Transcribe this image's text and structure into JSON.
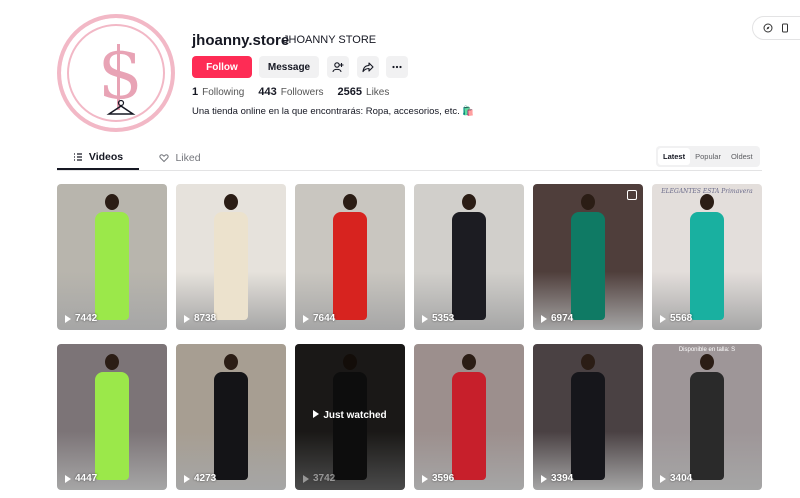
{
  "profile": {
    "username": "jhoanny.store",
    "nickname": "JHOANNY STORE",
    "bio": "Una tienda online en la que encontrarás: Ropa, accesorios, etc. 🛍️",
    "logo_colors": {
      "ring": "#f2b8c6",
      "letter": "#e8a3b5"
    }
  },
  "actions": {
    "follow_label": "Follow",
    "message_label": "Message",
    "icons": [
      "add-friend-icon",
      "share-icon",
      "more-icon"
    ]
  },
  "stats": {
    "following_value": "1",
    "following_label": "Following",
    "followers_value": "443",
    "followers_label": "Followers",
    "likes_value": "2565",
    "likes_label": "Likes"
  },
  "tabs": {
    "videos": "Videos",
    "liked": "Liked"
  },
  "sort": {
    "latest": "Latest",
    "popular": "Popular",
    "oldest": "Oldest"
  },
  "videos": [
    {
      "views": "7442",
      "bg": "#b8b5ad",
      "outfit": "#9be84a"
    },
    {
      "views": "8738",
      "bg": "#e6e2dc",
      "outfit": "#ece2cd"
    },
    {
      "views": "7644",
      "bg": "#c9c6c0",
      "outfit": "#d7231f"
    },
    {
      "views": "5353",
      "bg": "#d1cfcb",
      "outfit": "#1c1c22"
    },
    {
      "views": "6974",
      "bg": "#4f3e3b",
      "outfit": "#0f7a64"
    },
    {
      "views": "5568",
      "bg": "#e3dedb",
      "outfit": "#19b0a0",
      "caption": "ELEGANTES ESTA Primavera"
    },
    {
      "views": "4447",
      "bg": "#7c7477",
      "outfit": "#9be84a"
    },
    {
      "views": "4273",
      "bg": "#a79e92",
      "outfit": "#141417"
    },
    {
      "views": "3742",
      "bg": "#3a3733",
      "outfit": "#1e1e1e",
      "watched": "Just watched"
    },
    {
      "views": "3596",
      "bg": "#9c8f8d",
      "outfit": "#c71f2b"
    },
    {
      "views": "3394",
      "bg": "#4a4143",
      "outfit": "#16161b"
    },
    {
      "views": "3404",
      "bg": "#9e9698",
      "outfit": "#2a2a2a",
      "caption": "Disponible en talla: S"
    }
  ]
}
